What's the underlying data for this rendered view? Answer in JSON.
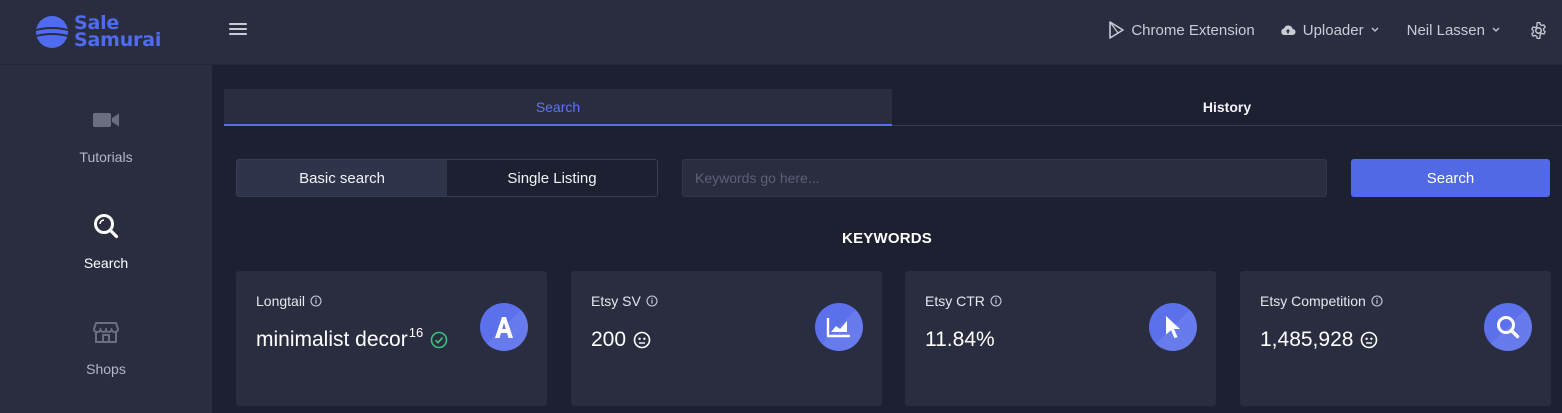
{
  "brand": {
    "line1": "Sale",
    "line2": "Samurai"
  },
  "topnav": {
    "chrome_extension": "Chrome Extension",
    "uploader": "Uploader",
    "user": "Neil Lassen"
  },
  "sidebar": {
    "items": [
      {
        "label": "Tutorials",
        "icon": "video-camera-icon"
      },
      {
        "label": "Search",
        "icon": "search-icon",
        "active": true
      },
      {
        "label": "Shops",
        "icon": "store-icon"
      }
    ]
  },
  "tabs": {
    "search": "Search",
    "history": "History"
  },
  "search_modes": {
    "basic": "Basic search",
    "single": "Single Listing",
    "selected": "Basic search"
  },
  "keyword_input": {
    "placeholder": "Keywords go here...",
    "value": ""
  },
  "search_button": "Search",
  "section_title": "KEYWORDS",
  "cards": [
    {
      "label": "Longtail",
      "value": "minimalist decor",
      "superscript": "16",
      "status": "check-circle-icon",
      "icon": "letter-a-icon"
    },
    {
      "label": "Etsy SV",
      "value": "200",
      "status": "neutral-face-icon",
      "icon": "trending-chart-icon"
    },
    {
      "label": "Etsy CTR",
      "value": "11.84%",
      "icon": "cursor-pointer-icon"
    },
    {
      "label": "Etsy Competition",
      "value": "1,485,928",
      "status": "neutral-face-icon",
      "icon": "magnifier-icon"
    }
  ],
  "colors": {
    "accent": "#5269e6",
    "background": "#1d2030",
    "panel": "#2a2d3f",
    "success": "#3fbf7f"
  }
}
